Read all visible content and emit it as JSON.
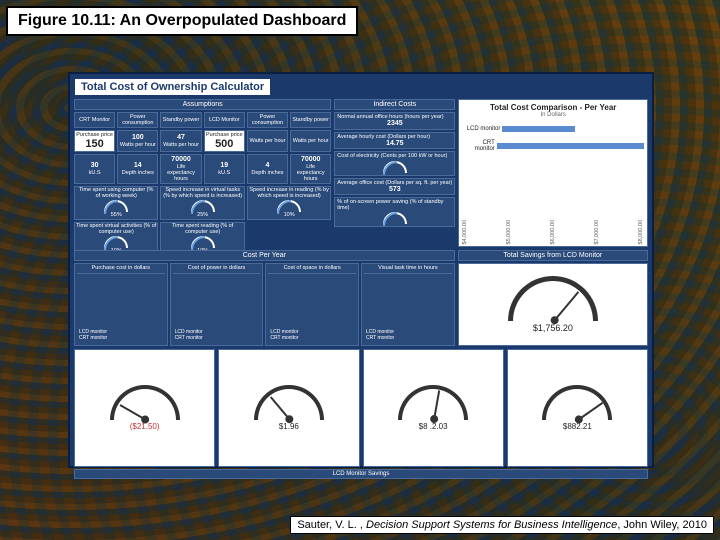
{
  "figure_label": "Figure 10.11:  An Overpopulated Dashboard",
  "citation": {
    "author": "Sauter, V. L. , ",
    "title": "Decision Support Systems for Business Intelligence",
    "publisher": ", John Wiley, 2010"
  },
  "dashboard_title": "Total Cost of Ownership Calculator",
  "sections": {
    "assumptions": "Assumptions",
    "indirect": "Indirect Costs",
    "comparison_title": "Total Cost Comparison - Per Year",
    "comparison_sub": "In Dollars",
    "cost_per_year": "Cost Per Year",
    "total_savings": "Total Savings from LCD Monitor",
    "lcd_savings": "LCD Monitor Savings"
  },
  "assump": {
    "hdr1": "CRT Monitor",
    "hdr2": "Power consumption",
    "hdr3": "Standby power",
    "hdr4": "LCD Monitor",
    "hdr5": "Power consumption",
    "hdr6": "Standby power",
    "crt_price_lbl": "Purchase price",
    "crt_price": "150",
    "crt_watts": "100",
    "crt_wlbl": "Watts per hour",
    "crt_stby": "47",
    "crt_slbl": "Watts per hour",
    "lcd_price_lbl": "Purchase price",
    "lcd_price": "500",
    "lcd_wlbl": "Watts per hour",
    "lcd_slbl": "Watts per hour",
    "r2a": "30",
    "r2b": "14",
    "r2c": "70000",
    "r2d": "19",
    "r2e": "4",
    "r2f": "70000",
    "r2a_l": "kU.S",
    "r2b_l": "Depth inches",
    "r2c_l": "Life expectancy hours",
    "r2d_l": "kU.S",
    "r2e_l": "Depth inches",
    "r2f_l": "Life expectancy hours",
    "g1": "Time spent using computer (% of working week)",
    "g2": "Speed increase in virtual tasks (% by which speed is increased)",
    "g3": "Speed increase in reading (% by which speed is increased)",
    "g1v": "55%",
    "g2v": "25%",
    "g3v": "10%",
    "g4": "Time spent virtual activities (% of computer use)",
    "g5": "Time spent reading (% of computer use)",
    "g4v": "10%",
    "g5v": "10%"
  },
  "indirect": {
    "i1": "Normal annual office hours (hours per year)",
    "i1v": "2345",
    "i2": "Average hourly cost (Dollars per hour)",
    "i2v": "14.75",
    "i3": "Cost of electricity (Cents per 100 kW or hour)",
    "i4": "Average office cost (Dollars per sq. ft. per year)",
    "i4v": "573",
    "i5": "% of on-screen power saving (% of standby time)"
  },
  "chart_data": {
    "type": "bar",
    "orientation": "horizontal",
    "categories": [
      "LCD monitor",
      "CRT monitor"
    ],
    "values": [
      5600,
      7800
    ],
    "xlabel": "",
    "ylabel": "",
    "xlim": [
      4000,
      8000
    ],
    "xticks": [
      "$4,000.00",
      "$5,000.00",
      "$6,000.00",
      "$7,000.00",
      "$8,000.00"
    ]
  },
  "cost_panels": {
    "p1": "Purchase cost in dollars",
    "p2": "Cost of power in dollars",
    "p3": "Cost of space in dollars",
    "p4": "Visual task time in hours",
    "row_a": "LCD monitor",
    "row_b": "CRT monitor"
  },
  "big_gauge": "$1,756.20",
  "bot_gauges": {
    "g1": "($21.50)",
    "g2": "$1.96",
    "g3": "$8 .2.03",
    "g4": "$882.21"
  }
}
